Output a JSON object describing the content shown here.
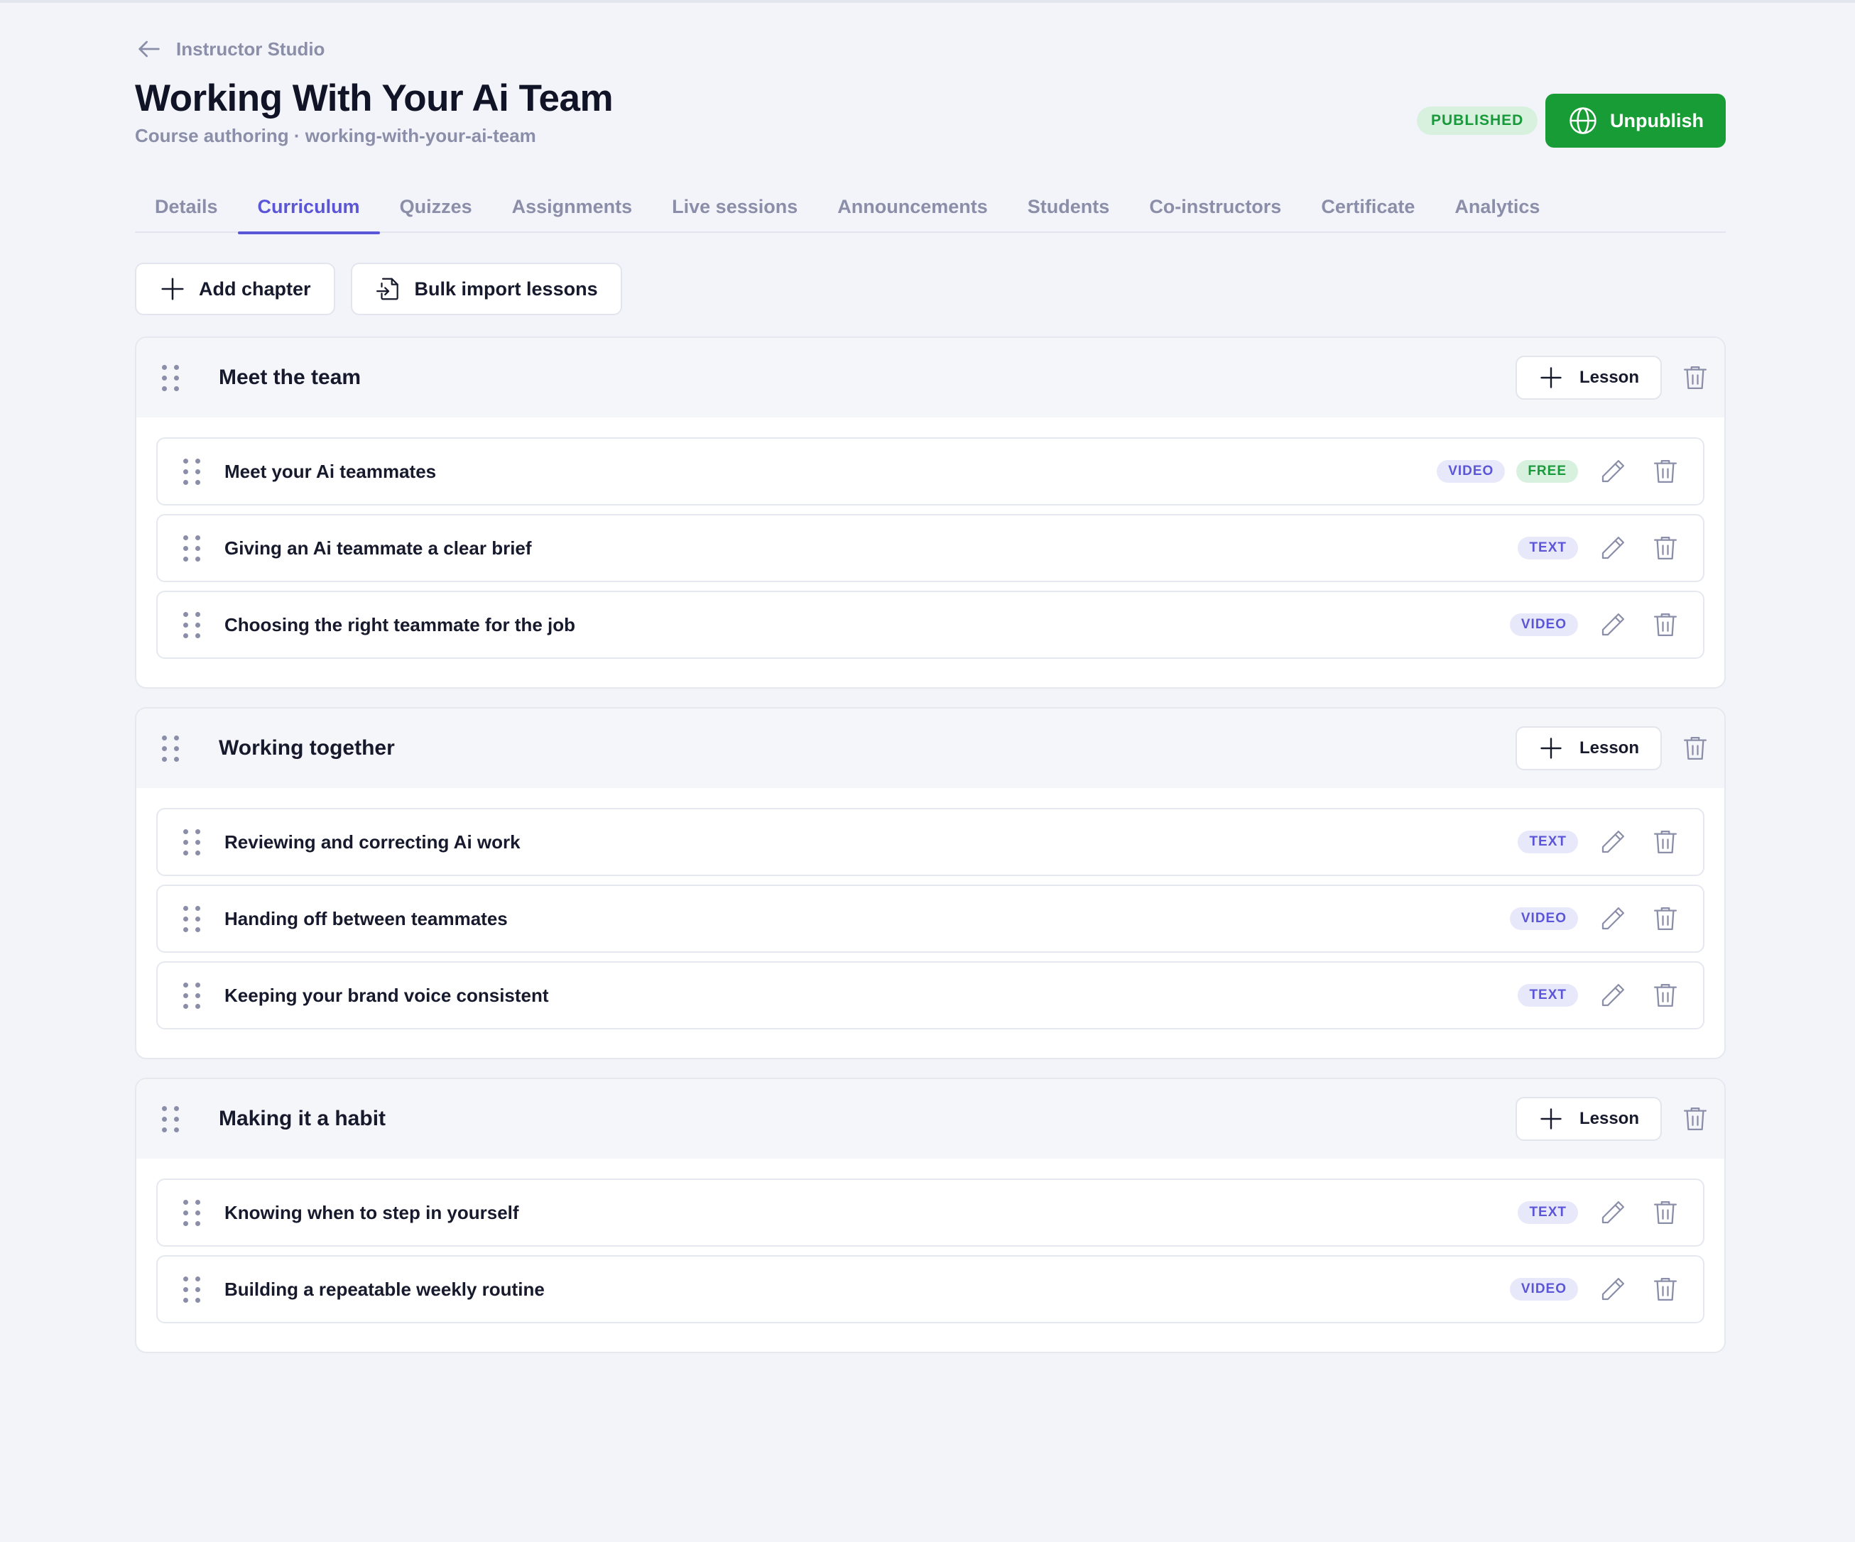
{
  "header": {
    "back_label": "Instructor Studio",
    "title": "Working With Your Ai Team",
    "subtitle": "Course authoring · working-with-your-ai-team",
    "status": "PUBLISHED",
    "publish_button": "Unpublish"
  },
  "tabs": [
    {
      "label": "Details"
    },
    {
      "label": "Curriculum",
      "active": true
    },
    {
      "label": "Quizzes"
    },
    {
      "label": "Assignments"
    },
    {
      "label": "Live sessions"
    },
    {
      "label": "Announcements"
    },
    {
      "label": "Students"
    },
    {
      "label": "Co-instructors"
    },
    {
      "label": "Certificate"
    },
    {
      "label": "Analytics"
    }
  ],
  "toolbar": {
    "add_chapter": "Add chapter",
    "bulk_import": "Bulk import lessons"
  },
  "add_lesson_label": "Lesson",
  "colors": {
    "accent": "#5b55d8",
    "publish_green": "#189c35",
    "free_badge_bg": "#d8f1df"
  },
  "chapters": [
    {
      "title": "Meet the team",
      "lessons": [
        {
          "title": "Meet your Ai teammates",
          "type": "VIDEO",
          "free": "FREE"
        },
        {
          "title": "Giving an Ai teammate a clear brief",
          "type": "TEXT"
        },
        {
          "title": "Choosing the right teammate for the job",
          "type": "VIDEO"
        }
      ]
    },
    {
      "title": "Working together",
      "lessons": [
        {
          "title": "Reviewing and correcting Ai work",
          "type": "TEXT"
        },
        {
          "title": "Handing off between teammates",
          "type": "VIDEO"
        },
        {
          "title": "Keeping your brand voice consistent",
          "type": "TEXT"
        }
      ]
    },
    {
      "title": "Making it a habit",
      "lessons": [
        {
          "title": "Knowing when to step in yourself",
          "type": "TEXT"
        },
        {
          "title": "Building a repeatable weekly routine",
          "type": "VIDEO"
        }
      ]
    }
  ]
}
